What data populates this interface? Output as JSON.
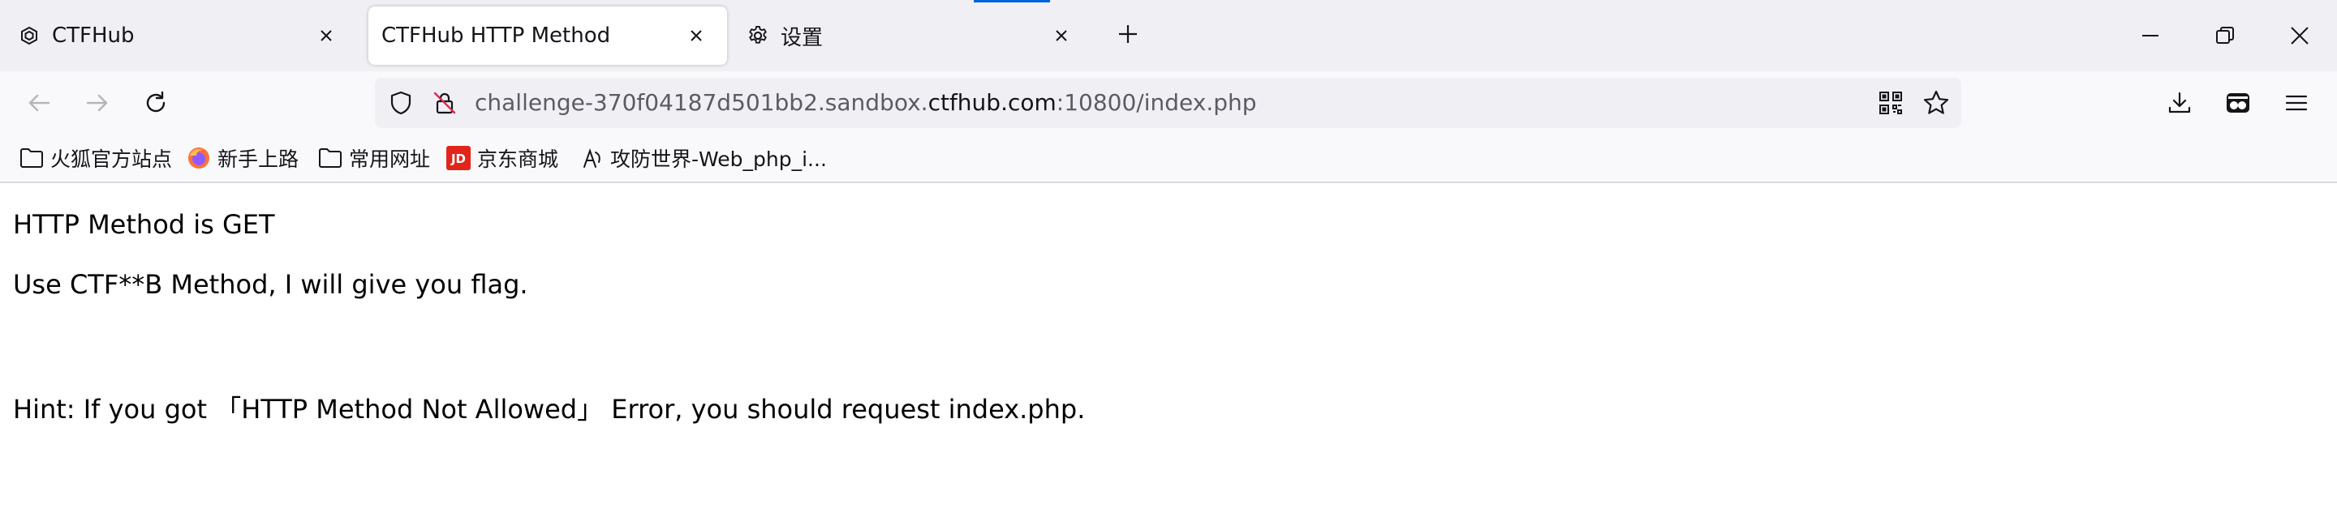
{
  "tabs": [
    {
      "title": "CTFHub",
      "icon": "ctfhub-favicon",
      "active": false
    },
    {
      "title": "CTFHub HTTP Method",
      "icon": "none",
      "active": true
    },
    {
      "title": "设置",
      "icon": "gear-icon",
      "active": false
    }
  ],
  "urlbar": {
    "url_prefix": "challenge-370f04187d501bb2.sandbox.",
    "url_host": "ctfhub.com",
    "url_suffix": ":10800/index.php"
  },
  "bookmarks": [
    {
      "label": "火狐官方站点",
      "icon": "folder-icon"
    },
    {
      "label": "新手上路",
      "icon": "firefox-icon"
    },
    {
      "label": "常用网址",
      "icon": "folder-icon"
    },
    {
      "label": "京东商城",
      "icon": "jd-icon"
    },
    {
      "label": "攻防世界-Web_php_i...",
      "icon": "adworld-icon"
    }
  ],
  "page": {
    "line1": "HTTP Method is GET",
    "line2": "Use CTF**B Method, I will give you flag.",
    "line3": "Hint: If you got 「HTTP Method Not Allowed」 Error, you should request index.php."
  },
  "colors": {
    "accent": "#0061e0",
    "tabstrip": "#f0f0f4",
    "toolbar": "#f9f9fb",
    "jd_red": "#e1251b"
  }
}
